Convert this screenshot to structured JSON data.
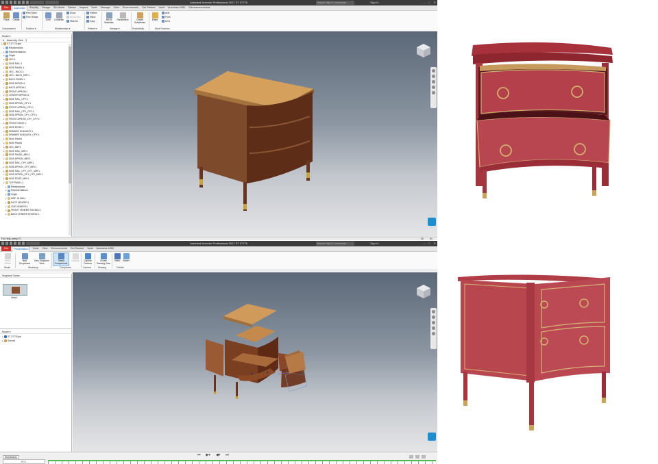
{
  "top_window": {
    "title": "Autodesk Inventor Professional 2017    ST 37776",
    "search_placeholder": "Search Help & Commands...",
    "signin": "Sign In",
    "tabs": [
      "File",
      "Assemble",
      "Simplify",
      "Design",
      "3D Model",
      "Sketch",
      "Inspect",
      "Tools",
      "Manage",
      "View",
      "Environments",
      "Get Started",
      "Vault",
      "Autodesk A360",
      "Electromechanical"
    ],
    "active_tab": "Assemble",
    "ribbon": {
      "place": "Place",
      "create": "Create",
      "free_move": "Free Move",
      "free_rotate": "Free Rotate",
      "joint": "Joint",
      "constrain": "Constrain",
      "show": "Show",
      "show_sick": "Show Sick",
      "hide_all": "Hide All",
      "pattern": "Pattern",
      "mirror": "Mirror",
      "copy": "Copy",
      "bill_of_materials": "Bill of Materials",
      "parameters": "Parameters",
      "create_substitutes": "Create Substitutes",
      "plane": "Plane",
      "axis": "Axis",
      "point": "Point",
      "ucs": "UCS",
      "groups": [
        "Component ▾",
        "Position ▾",
        "Relationships ▾",
        "Pattern ▾",
        "Manage ▾",
        "Productivity",
        "Work Features"
      ]
    },
    "browser": {
      "header": "Model ▾",
      "view_label": "Assembly View",
      "items": [
        "ST 37776.iam",
        "Relationships",
        "Representations",
        "Origin",
        "LEG:1",
        "SIDE RAIL:1",
        "SIDE PANEL:1",
        "LEG - BACK:1",
        "LEG - BACK_MIR:1",
        "BACK PANEL:1",
        "SIDE APRON:1",
        "BACK APRON:1",
        "FRONT APRON:1",
        "CENTER APRON:1",
        "SIDE RAIL_CPY:1",
        "SIDE APRON_CPY:1",
        "FRONT APRON_CPY:1",
        "SIDE RAIL_CPY_CPY:1",
        "SIDE APRON_CPY_CPY:1",
        "FRONT APRON_CPY_CPY:1",
        "FRONT EDGE:1",
        "SIDE EDGE:1",
        "DRAWER SUB ASSY:1",
        "DRAWER SUB ASSY_CPY:1",
        "Work Plane1",
        "Work Plane1",
        "LEG_MIR:1",
        "SIDE RAIL_MIR:1",
        "SIDE PANEL_MIR:1",
        "SIDE APRON_MIR:1",
        "SIDE RAIL_CPY_MIR:1",
        "SIDE APRON_CPY_MIR:1",
        "SIDE RAIL_CPY_CPY_MIR:1",
        "SIDE APRON_CPY_CPY_MIR:1",
        "SIDE EDGE_MIR:1",
        "TOP PANEL:1",
        "Relationships",
        "Representations",
        "Origin",
        "MDF 18 MM:1",
        "FACE VENEER:1",
        "OVE VENEER:1",
        "FRONT VENEER EDGING:1",
        "BACK VENEER EDGING:1"
      ]
    },
    "status": "For Help, press F1",
    "status_nums": [
      "30",
      "91"
    ]
  },
  "bottom_window": {
    "title": "Autodesk Inventor Professional 2017    ST 37776",
    "search_placeholder": "Search Help & Commands...",
    "signin": "Sign In",
    "tabs": [
      "File",
      "Presentation",
      "Tools",
      "View",
      "Environments",
      "Get Started",
      "Vault",
      "Autodesk A360"
    ],
    "active_tab": "Presentation",
    "ribbon": {
      "insert_model": "Insert Model",
      "new_storyboard": "New Storyboard",
      "new_snapshot_view": "New Snapshot View",
      "tweak_components": "Tweak Components",
      "opacity": "Opacity",
      "capture_camera": "Capture Camera",
      "create_drawing_view": "Create Drawing View",
      "video": "Video",
      "raster": "Raster",
      "groups": [
        "Model",
        "Workshop",
        "Component",
        "Camera",
        "Drawing",
        "Publish"
      ]
    },
    "snapshot_panel": {
      "header": "Snapshot Views",
      "view_label": "View1"
    },
    "model_panel": {
      "header": "Model ▾",
      "items": [
        "ST 37776.ipn",
        "Scene1"
      ]
    },
    "storyboard_tab": "Storyboard1",
    "timeline_time": "07.5"
  },
  "colors": {
    "titlebar": "#3c3c3c",
    "file_tab": "#d0342c",
    "viewport_top": "#5b6877",
    "wood_top": "#c8954e",
    "wood_body": "#6e3a22",
    "chest_red": "#b2404a",
    "brass": "#c8a45a"
  }
}
